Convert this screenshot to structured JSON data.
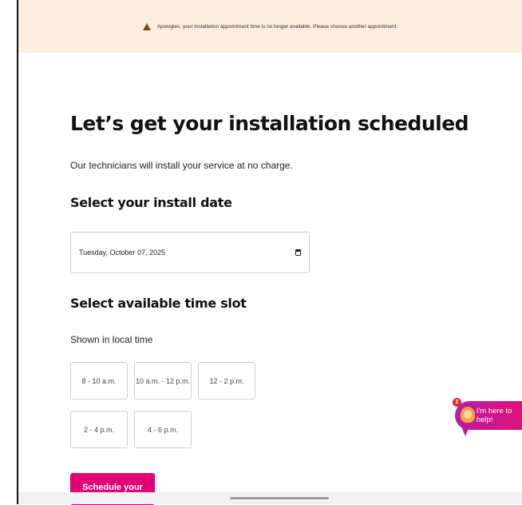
{
  "banner": {
    "icon": "warning-triangle-icon",
    "message": "Apologies, your installation appointment time is no longer available. Please choose another appointment."
  },
  "page": {
    "title": "Let’s get your installation scheduled",
    "subtitle": "Our technicians will install your service at no charge."
  },
  "date_section": {
    "heading": "Select your install date",
    "value": "Tuesday, October 07, 2025",
    "icon": "calendar-icon"
  },
  "time_section": {
    "heading": "Select available time slot",
    "note": "Shown in local time",
    "slots": [
      "8 - 10 a.m.",
      "10 a.m. - 12 p.m.",
      "12 - 2 p.m.",
      "2 - 4 p.m.",
      "4 - 6 p.m."
    ]
  },
  "cta": {
    "label": "Schedule your install"
  },
  "chat": {
    "label": "I'm here to help!",
    "badge_count": "2",
    "accent": "#e20074"
  },
  "colors": {
    "brand": "#e20074",
    "banner_bg": "#fbeedd",
    "warning_icon": "#7a4b16"
  }
}
